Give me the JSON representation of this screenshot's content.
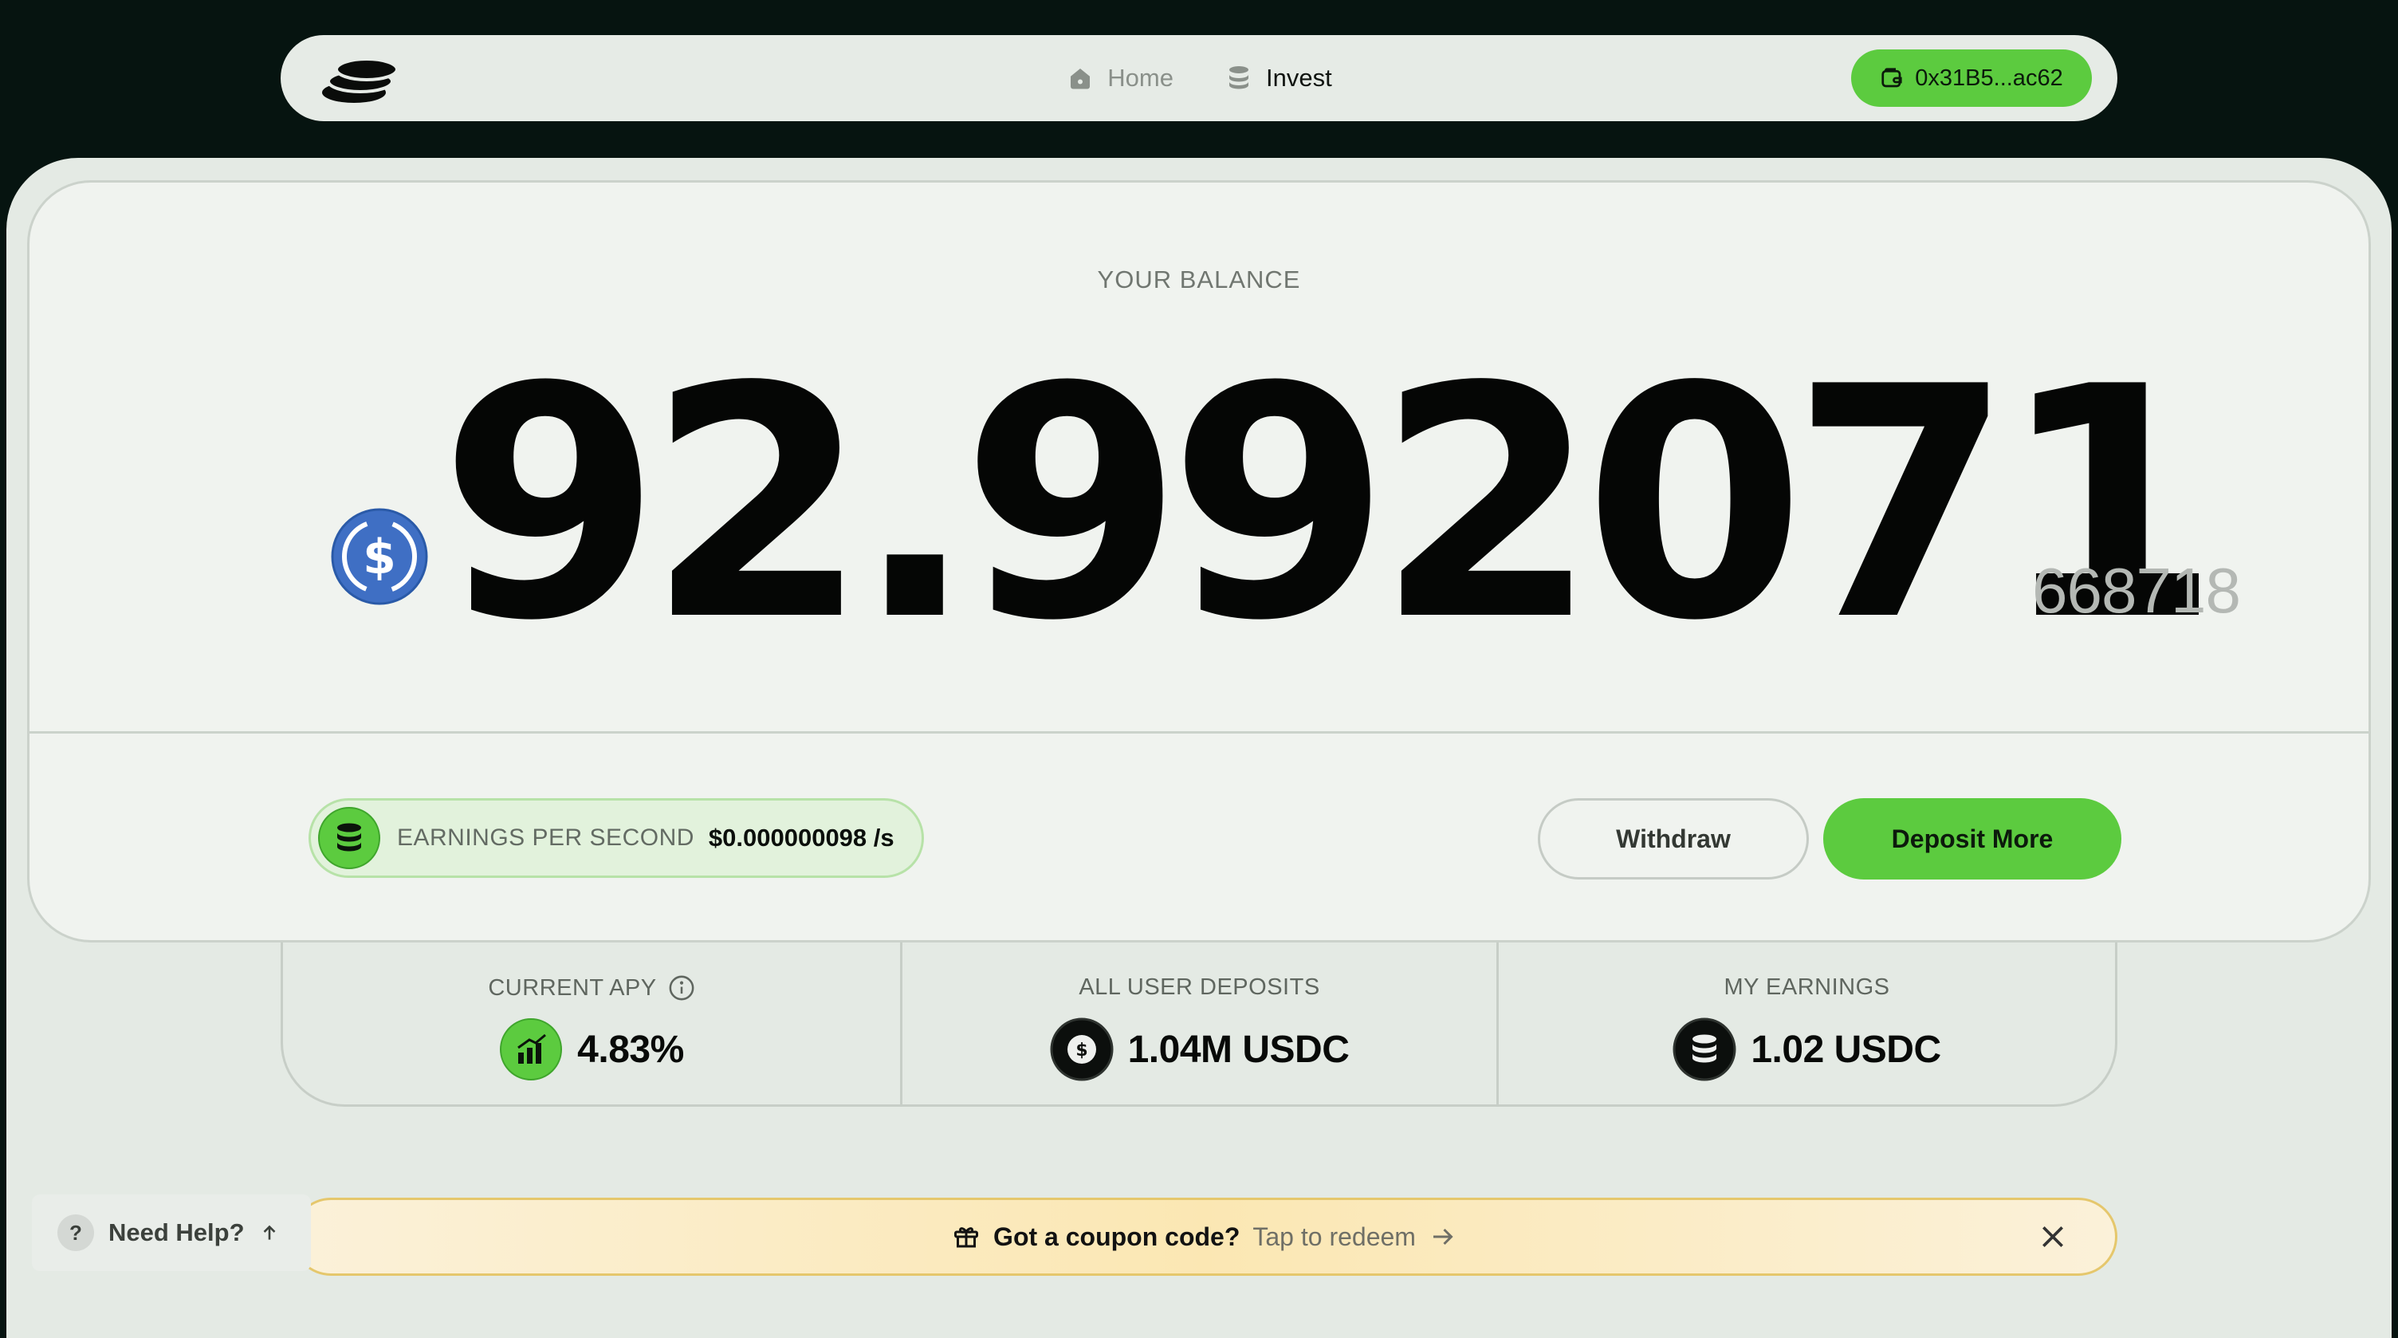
{
  "nav": {
    "home_label": "Home",
    "invest_label": "Invest",
    "wallet_address": "0x31B5...ac62"
  },
  "balance": {
    "label": "YOUR BALANCE",
    "main": "92.992071",
    "sub": "668718",
    "token": "USDC"
  },
  "earnings_per_second": {
    "label": "EARNINGS PER SECOND",
    "value": "$0.000000098 /s"
  },
  "actions": {
    "withdraw_label": "Withdraw",
    "deposit_label": "Deposit More"
  },
  "stats": [
    {
      "label": "CURRENT APY",
      "value": "4.83%",
      "icon": "trend-up-icon"
    },
    {
      "label": "ALL USER DEPOSITS",
      "value": "1.04M USDC",
      "icon": "dollar-coin-icon"
    },
    {
      "label": "MY EARNINGS",
      "value": "1.02 USDC",
      "icon": "coin-stack-icon"
    }
  ],
  "coupon": {
    "title": "Got a coupon code?",
    "link": "Tap to redeem"
  },
  "help": {
    "label": "Need Help?",
    "badge": "?"
  },
  "colors": {
    "accent_green": "#5ccb3f",
    "page_background": "#061410",
    "sheet_background": "#e4eae4",
    "card_background": "#f0f3ef",
    "usdc_blue": "#2775ca",
    "coupon_border": "#e5c76c"
  }
}
